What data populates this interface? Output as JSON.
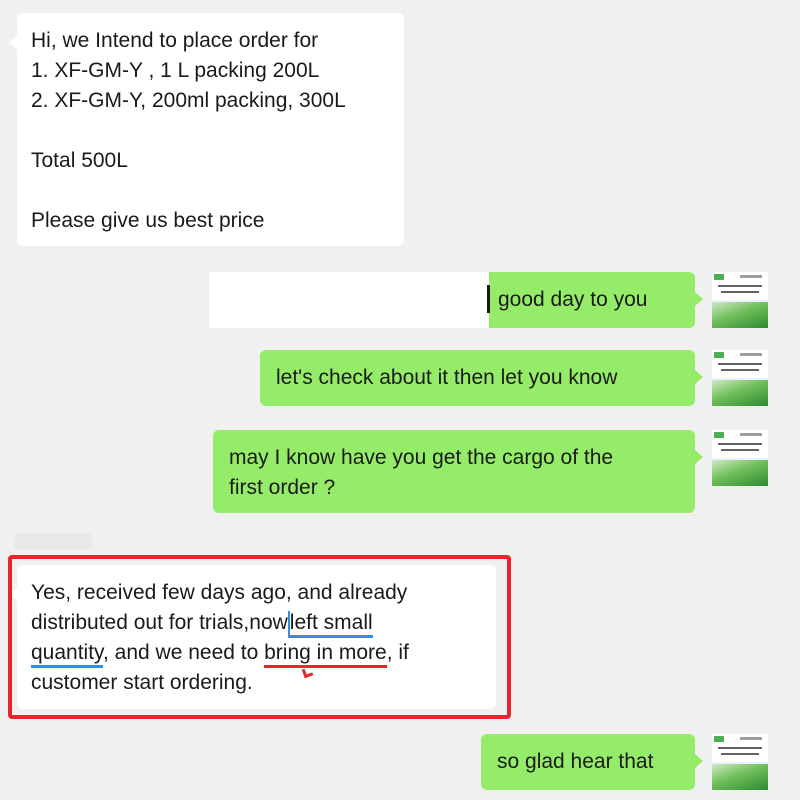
{
  "conversation": {
    "messages": [
      {
        "from": "contact",
        "lines": [
          "Hi, we Intend to place order for",
          "1. XF-GM-Y , 1 L packing 200L",
          "2. XF-GM-Y, 200ml packing, 300L",
          "",
          "Total 500L",
          "",
          "Please give us best price"
        ]
      },
      {
        "from": "me",
        "text": "good day to you"
      },
      {
        "from": "me",
        "text": "let's check about it then let you know"
      },
      {
        "from": "me",
        "lines": [
          "may I know have you get the cargo of the",
          "first order ?"
        ]
      },
      {
        "from": "contact",
        "highlighted": true,
        "line1": "Yes, received few days ago, and already",
        "line2_a": "distributed out for trials,now",
        "line2_underlined": "left small",
        "line3_underlined": "quantity",
        "line3_b": ", and we need to ",
        "line3_underlined_red": "bring in more",
        "line3_c": ", if",
        "line4": "customer start ordering."
      },
      {
        "from": "me",
        "text": "so glad hear that"
      }
    ]
  },
  "colors": {
    "chat_background": "#f0f0f0",
    "incoming_bubble": "#ffffff",
    "outgoing_bubble": "#95ec69",
    "highlight_frame": "#e8252a",
    "blue_underline": "#2b8ef0",
    "red_underline": "#e8252a"
  },
  "icons": {
    "my_avatar": "company-brochure-avatar"
  }
}
